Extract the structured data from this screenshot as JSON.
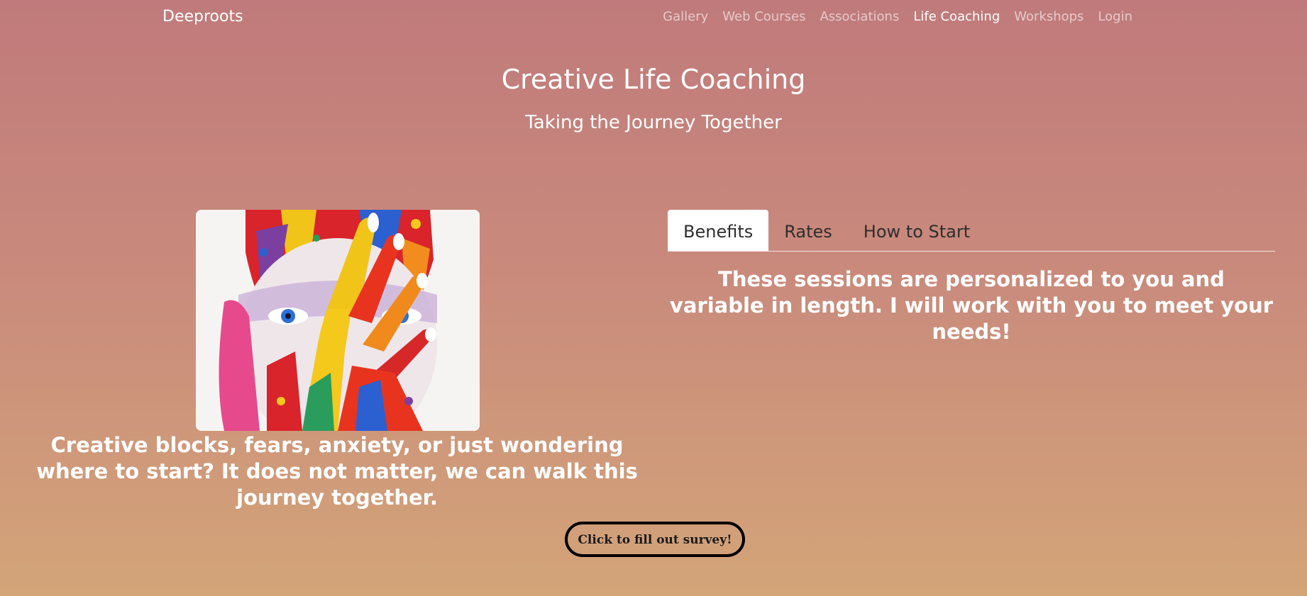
{
  "navbar": {
    "brand": "Deeproots",
    "links": [
      {
        "label": "Gallery"
      },
      {
        "label": "Web Courses"
      },
      {
        "label": "Associations"
      },
      {
        "label": "Life Coaching",
        "active": true
      },
      {
        "label": "Workshops"
      },
      {
        "label": "Login"
      }
    ]
  },
  "hero": {
    "title": "Creative Life Coaching",
    "subtitle": "Taking the Journey Together"
  },
  "left": {
    "image_icon": "painted-face-photo",
    "text": "Creative blocks, fears, anxiety, or just wondering where to start? It does not matter, we can walk this journey together."
  },
  "tabs": {
    "items": [
      {
        "label": "Benefits",
        "active": true
      },
      {
        "label": "Rates"
      },
      {
        "label": "How to Start"
      }
    ],
    "content": "These sessions are personalized to you and variable in length. I will work with you to meet your needs!"
  },
  "survey": {
    "button_label": "Click to fill out survey!"
  },
  "colors": {
    "background_top": "#c07a7b",
    "background_bottom": "#d3a478",
    "active_tab_bg": "#ffffff",
    "button_border": "#000000"
  }
}
